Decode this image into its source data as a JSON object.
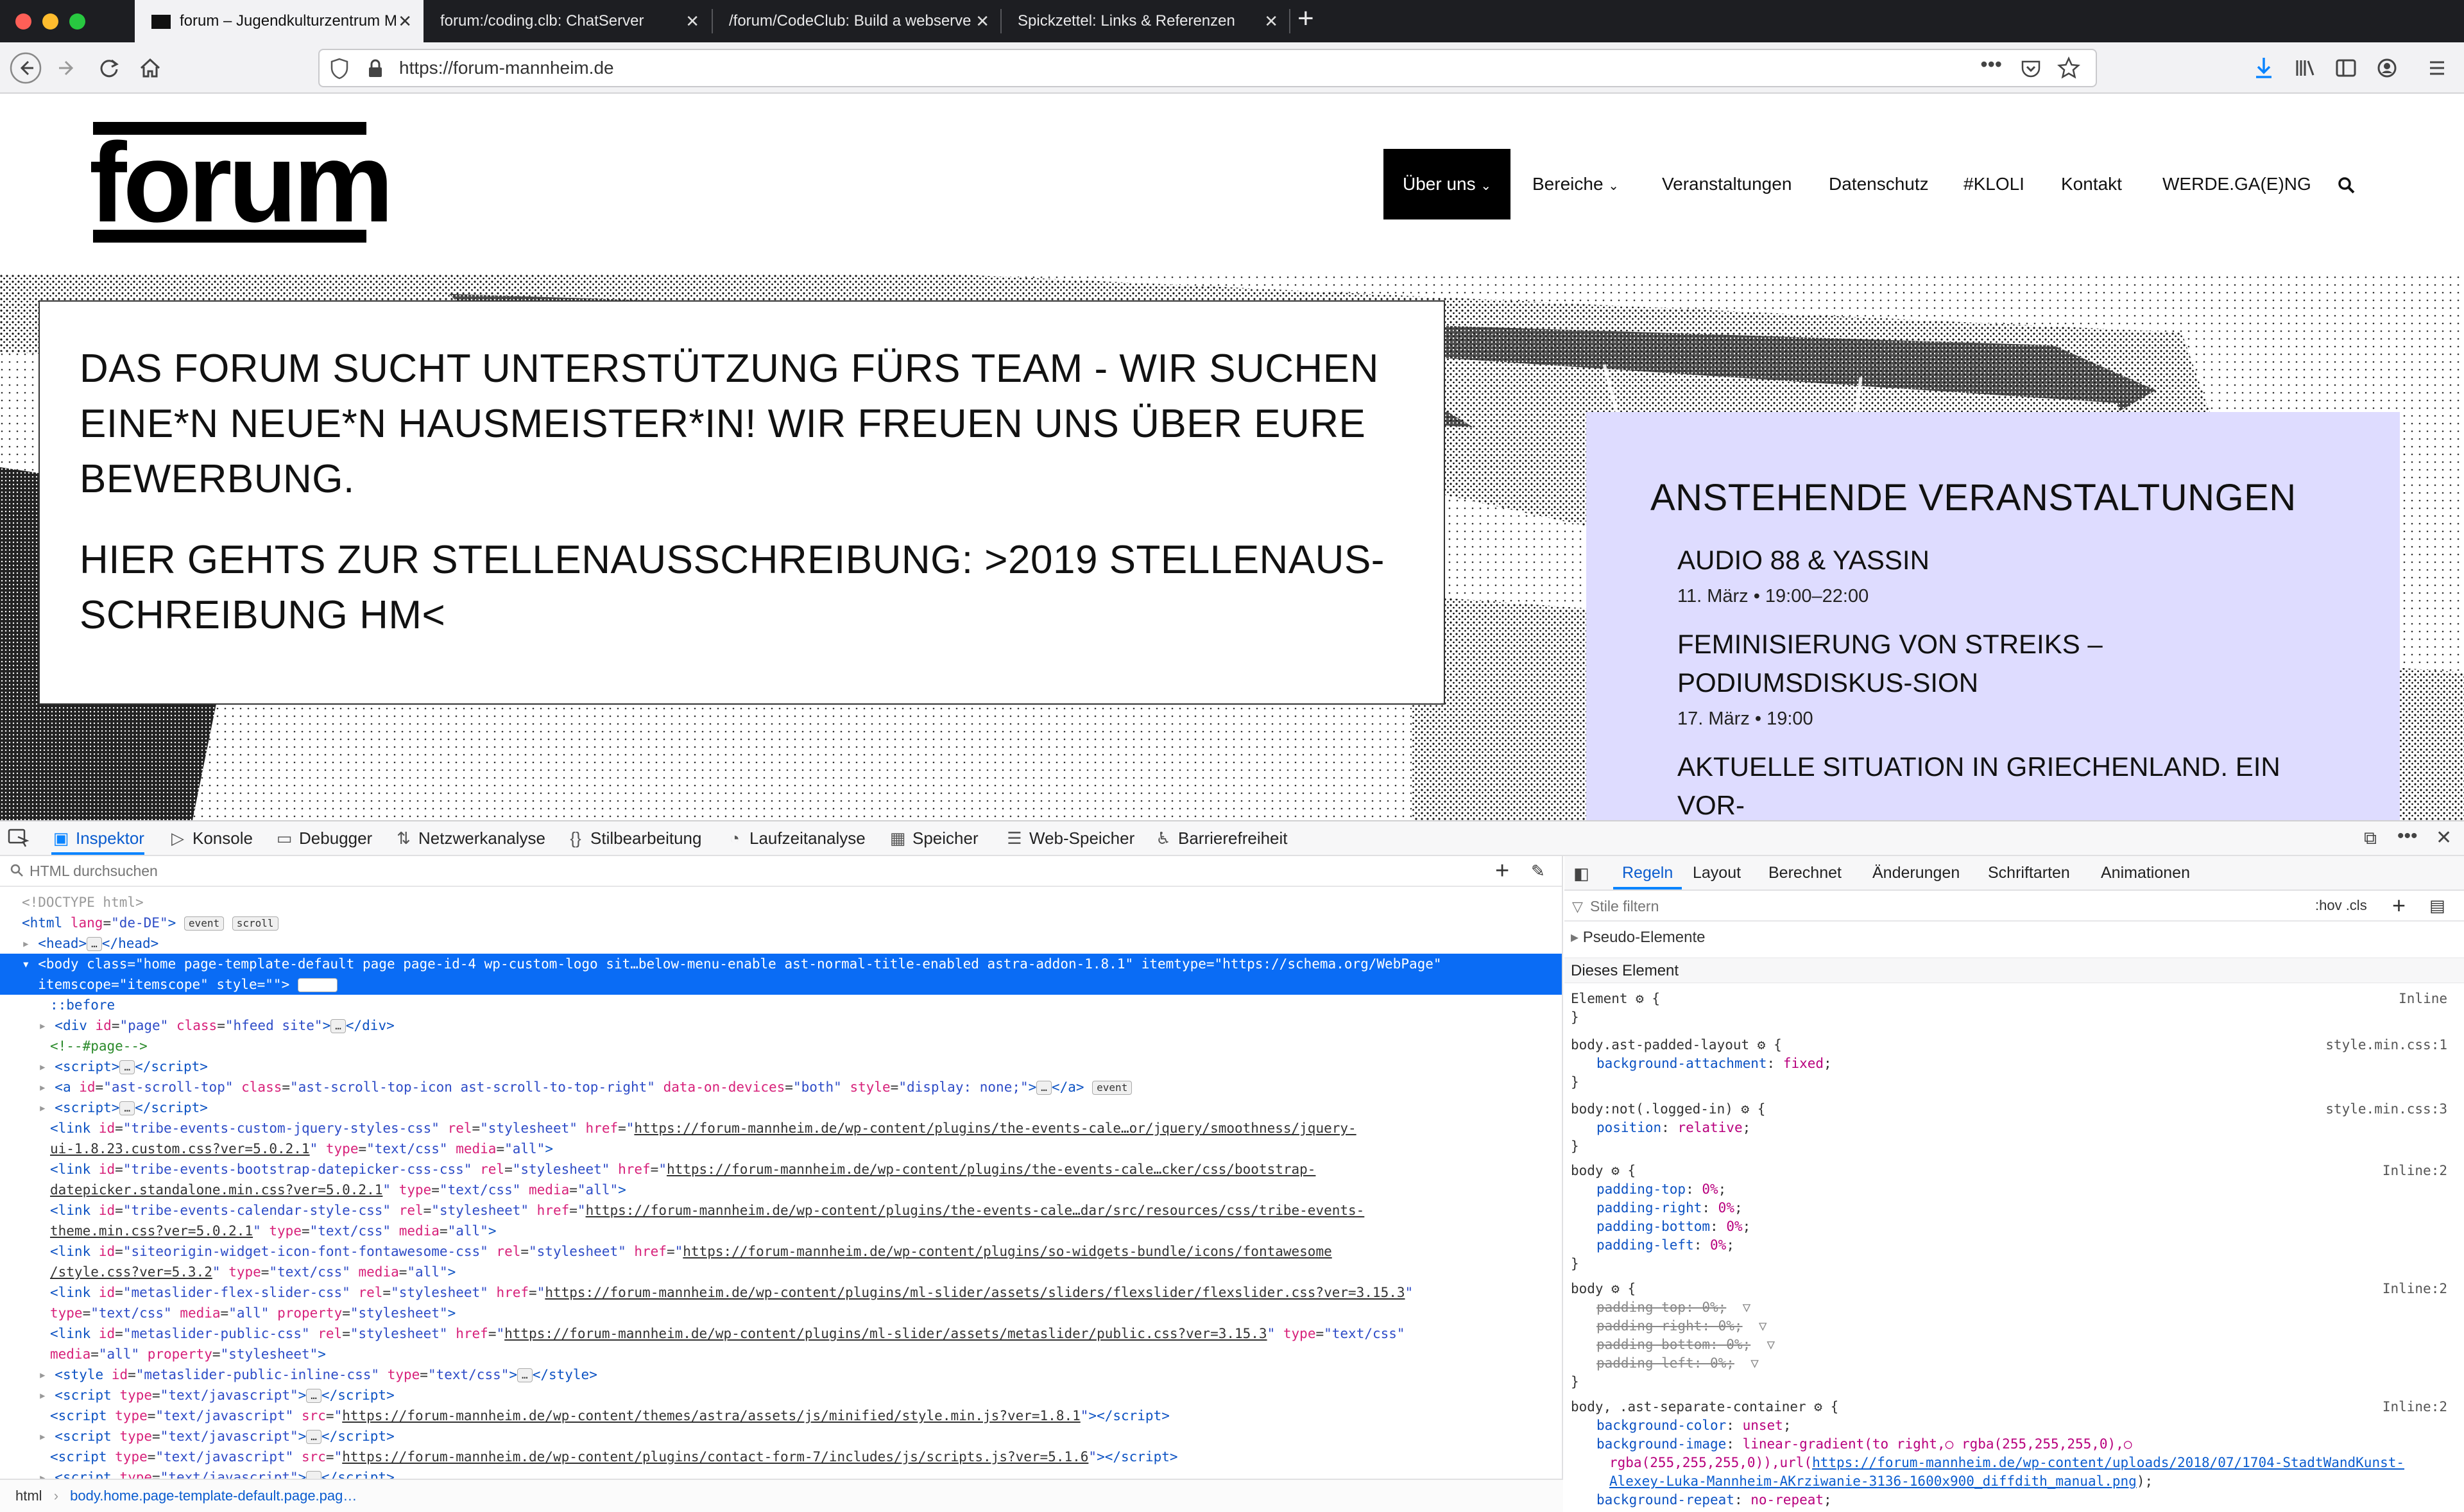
{
  "browser": {
    "tabs": [
      {
        "label": "forum – Jugendkulturzentrum M"
      },
      {
        "label": "forum:/coding.clb: ChatServer"
      },
      {
        "label": "/forum/CodeClub: Build a webserve"
      },
      {
        "label": "Spickzettel: Links & Referenzen"
      }
    ],
    "url": "https://forum-mannheim.de"
  },
  "site": {
    "logo_text": "forum",
    "menu": [
      {
        "label": "Über uns",
        "chevron": "⌄"
      },
      {
        "label": "Bereiche",
        "chevron": "⌄"
      },
      {
        "label": "Veranstaltungen"
      },
      {
        "label": "Datenschutz"
      },
      {
        "label": "#KLOLI"
      },
      {
        "label": "Kontakt"
      },
      {
        "label": "WERDE.GA(E)NG"
      }
    ],
    "notice": {
      "line1": "DAS FORUM SUCHT UNTERSTÜTZUNG FÜRS TEAM - WIR SUCHEN EINE*N NEUE*N HAUSMEISTER*IN! WIR FREUEN UNS ÜBER EURE BEWERBUNG.",
      "line2": "HIER GEHTS ZUR STELLENAUSSCHREIBUNG: >2019 STELLENAUS-SCHREIBUNG HM<"
    },
    "events": {
      "heading": "ANSTEHENDE VERANSTALTUNGEN",
      "items": [
        {
          "title": "AUDIO 88 & YASSIN",
          "date": "11. März • 19:00–22:00"
        },
        {
          "title": "FEMINISIERUNG VON STREIKS – PODIUMSDISKUS-SION",
          "date": "17. März • 19:00"
        },
        {
          "title": "AKTUELLE SITUATION IN GRIECHENLAND. EIN VOR-",
          "date": ""
        }
      ]
    }
  },
  "devtools": {
    "tabs": [
      "Inspektor",
      "Konsole",
      "Debugger",
      "Netzwerkanalyse",
      "Stilbearbeitung",
      "Laufzeitanalyse",
      "Speicher",
      "Web-Speicher",
      "Barrierefreiheit"
    ],
    "search_placeholder": "HTML durchsuchen",
    "breadcrumb": [
      "html",
      "body.home.page-template-default.page.pag…"
    ],
    "rule_tabs": [
      "Regeln",
      "Layout",
      "Berechnet",
      "Änderungen",
      "Schriftarten",
      "Animationen"
    ],
    "filter_placeholder": "Stile filtern",
    "pseudo_toggle": ":hov  .cls",
    "pseudo_elements": "Pseudo-Elemente",
    "this_element": "Dieses Element"
  }
}
